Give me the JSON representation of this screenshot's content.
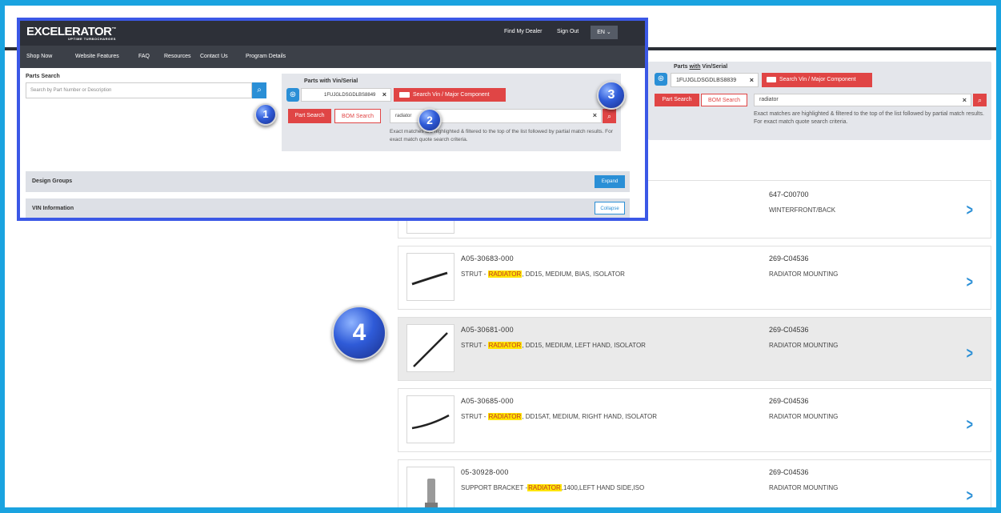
{
  "colors": {
    "accent_blue": "#2a8fd6",
    "accent_red": "#e04545",
    "frame_blue": "#1aa3e0",
    "highlight_yellow": "#ffe500"
  },
  "brand": {
    "logo_text": "EXCELERATOR",
    "logo_tm": "™",
    "logo_sub": "UPTIME TURBOCHARGES"
  },
  "header": {
    "find_dealer": "Find My Dealer",
    "sign_out": "Sign Out",
    "language": "EN ⌄"
  },
  "nav": [
    "Shop Now",
    "Website Features",
    "FAQ",
    "Resources",
    "Contact Us",
    "Program Details"
  ],
  "parts_search": {
    "label": "Parts Search",
    "placeholder": "Search by Part Number or Description"
  },
  "vin_panel": {
    "label": "Parts with Vin/Serial",
    "label_with": "with",
    "label_prefix": "Parts ",
    "label_suffix": " Vin/Serial",
    "vin_value": "1FUJGLDSGDLBS8849",
    "vin_value_bg": "1FUJGLDSGDLBS8839",
    "search_vin_button": "Search Vin / Major Component",
    "part_search_tab": "Part Search",
    "bom_search_tab": "BOM Search",
    "query_value": "radiator",
    "hint": "Exact matches are highlighted & filtered to the top of the list followed by partial match results. For exact match quote search criteria."
  },
  "sections": [
    {
      "title": "Design Groups",
      "button": "Expand"
    },
    {
      "title": "VIN Information",
      "button": "Collapse"
    }
  ],
  "markers": [
    "1",
    "2",
    "3",
    "4"
  ],
  "results": [
    {
      "part_number": "",
      "desc_before": "",
      "desc_highlight": "",
      "desc_after": "",
      "group_code": "647-C00700",
      "group_name": "WINTERFRONT/BACK"
    },
    {
      "part_number": "A05-30683-000",
      "desc_before": "STRUT - ",
      "desc_highlight": "RADIATOR",
      "desc_after": ", DD15, MEDIUM, BIAS, ISOLATOR",
      "group_code": "269-C04536",
      "group_name": "RADIATOR MOUNTING"
    },
    {
      "part_number": "A05-30681-000",
      "desc_before": "STRUT - ",
      "desc_highlight": "RADIATOR",
      "desc_after": ", DD15, MEDIUM, LEFT HAND, ISOLATOR",
      "group_code": "269-C04536",
      "group_name": "RADIATOR MOUNTING"
    },
    {
      "part_number": "A05-30685-000",
      "desc_before": "STRUT - ",
      "desc_highlight": "RADIATOR",
      "desc_after": ", DD15AT, MEDIUM, RIGHT HAND, ISOLATOR",
      "group_code": "269-C04536",
      "group_name": "RADIATOR MOUNTING"
    },
    {
      "part_number": "05-30928-000",
      "desc_before": "SUPPORT BRACKET -",
      "desc_highlight": "RADIATOR",
      "desc_after": ",1400,LEFT HAND SIDE,ISO",
      "group_code": "269-C04536",
      "group_name": "RADIATOR MOUNTING"
    }
  ]
}
